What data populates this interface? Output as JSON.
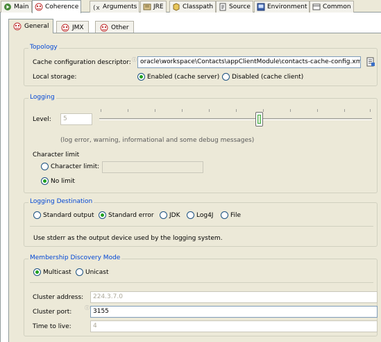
{
  "top_tabs": [
    {
      "label": "Main",
      "icon": "main-icon"
    },
    {
      "label": "Coherence",
      "icon": "coherence-icon"
    },
    {
      "label": "Arguments",
      "icon": "arguments-icon"
    },
    {
      "label": "JRE",
      "icon": "jre-icon"
    },
    {
      "label": "Classpath",
      "icon": "classpath-icon"
    },
    {
      "label": "Source",
      "icon": "source-icon"
    },
    {
      "label": "Environment",
      "icon": "environment-icon"
    },
    {
      "label": "Common",
      "icon": "common-icon"
    }
  ],
  "inner_tabs": [
    {
      "label": "General"
    },
    {
      "label": "JMX"
    },
    {
      "label": "Other"
    }
  ],
  "topology": {
    "title": "Topology",
    "descriptor_label": "Cache configuration descriptor:",
    "descriptor_value": "oracle\\workspace\\Contacts\\appClientModule\\contacts-cache-config.xml",
    "storage_label": "Local storage:",
    "storage_enabled": "Enabled (cache server)",
    "storage_disabled": "Disabled (cache client)"
  },
  "logging": {
    "title": "Logging",
    "level_label": "Level:",
    "level_value": "5",
    "level_hint": "(log error, warning, informational and some debug messages)",
    "level_fraction": 0.59,
    "char_limit_title": "Character limit",
    "char_limit_option": "Character limit:",
    "no_limit_option": "No limit"
  },
  "destination": {
    "title": "Logging Destination",
    "options": [
      "Standard output",
      "Standard error",
      "JDK",
      "Log4J",
      "File"
    ],
    "selected": "Standard error",
    "description": "Use stderr as the output device used by the logging system."
  },
  "membership": {
    "title": "Membership Discovery Mode",
    "multicast": "Multicast",
    "unicast": "Unicast",
    "cluster_address_label": "Cluster address:",
    "cluster_address_value": "224.3.7.0",
    "cluster_port_label": "Cluster port:",
    "cluster_port_value": "3155",
    "ttl_label": "Time to live:",
    "ttl_value": "4"
  },
  "colors": {
    "accent": "#0046d5",
    "radio_selected": "#21a121"
  }
}
